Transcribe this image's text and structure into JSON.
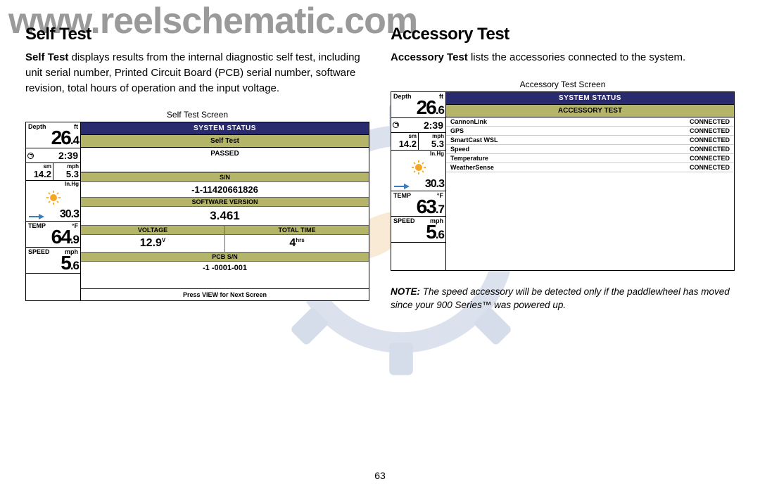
{
  "watermark": "www.reelschematic.com",
  "page_number": "63",
  "left": {
    "title": "Self Test",
    "description_bold": "Self Test",
    "description_rest": " displays results from the internal diagnostic self test, including unit serial number, Printed Circuit Board (PCB) serial number, software revision, total hours of operation and the input voltage.",
    "caption": "Self Test Screen",
    "sidebar": {
      "depth_label": "Depth",
      "depth_unit": "ft",
      "depth_val": "26",
      "depth_dec": ".4",
      "time_val": "2:39",
      "sm_label": "sm",
      "mph_label": "mph",
      "sm_val": "14.2",
      "mph_val": "5.3",
      "inhg_label": "In.Hg",
      "inhg_val": "30.3",
      "temp_label": "TEMP",
      "temp_unit": "°F",
      "temp_val": "64",
      "temp_dec": ".9",
      "speed_label": "SPEED",
      "speed_unit": "mph",
      "speed_val": "5",
      "speed_dec": ".6"
    },
    "panel": {
      "header": "SYSTEM STATUS",
      "sub": "Self Test",
      "passed": "PASSED",
      "sn_label": "S/N",
      "sn_val": "-1-11420661826",
      "sw_label": "SOFTWARE VERSION",
      "sw_val": "3.461",
      "voltage_label": "VOLTAGE",
      "voltage_val": "12.9",
      "voltage_unit": "V",
      "time_label": "TOTAL TIME",
      "time_val": "4",
      "time_unit": "hrs",
      "pcb_label": "PCB S/N",
      "pcb_val": "-1 -0001-001",
      "footer": "Press VIEW for Next Screen"
    }
  },
  "right": {
    "title": "Accessory Test",
    "description_bold": "Accessory Test",
    "description_rest": " lists the accessories connected to the system.",
    "caption": "Accessory Test Screen",
    "note_bold": "NOTE:",
    "note_rest": " The speed accessory will be detected only if the paddlewheel has moved since your 900 Series™ was powered up.",
    "sidebar": {
      "depth_label": "Depth",
      "depth_unit": "ft",
      "depth_val": "26",
      "depth_dec": ".6",
      "time_val": "2:39",
      "sm_label": "sm",
      "mph_label": "mph",
      "sm_val": "14.2",
      "mph_val": "5.3",
      "inhg_label": "In.Hg",
      "inhg_val": "30.3",
      "temp_label": "TEMP",
      "temp_unit": "°F",
      "temp_val": "63",
      "temp_dec": ".7",
      "speed_label": "SPEED",
      "speed_unit": "mph",
      "speed_val": "5",
      "speed_dec": ".6"
    },
    "panel": {
      "header": "SYSTEM STATUS",
      "sub": "ACCESSORY TEST",
      "accessories": [
        {
          "name": "CannonLink",
          "status": "CONNECTED"
        },
        {
          "name": "GPS",
          "status": "CONNECTED"
        },
        {
          "name": "SmartCast WSL",
          "status": "CONNECTED"
        },
        {
          "name": "Speed",
          "status": "CONNECTED"
        },
        {
          "name": "Temperature",
          "status": "CONNECTED"
        },
        {
          "name": "WeatherSense",
          "status": "CONNECTED"
        }
      ]
    }
  }
}
